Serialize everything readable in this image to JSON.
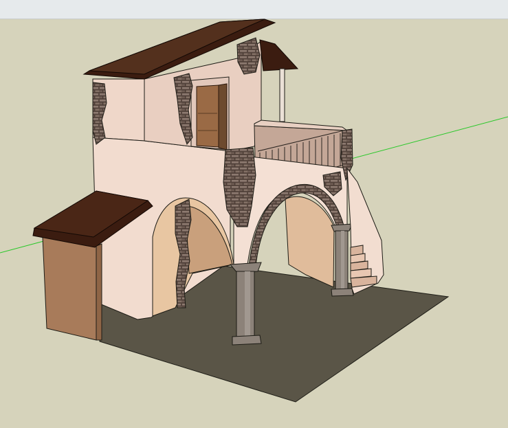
{
  "window": {
    "title": ""
  },
  "viewport": {
    "background": "#d6d3bb",
    "toolbar_background": "#e6eaec",
    "axis_green": "#28c828",
    "model": {
      "description_name": "two-storey-house-with-arched-loggia",
      "colors": {
        "plaster_light": "#f0d9cc",
        "plaster_mid": "#e2c3b4",
        "plaster_shadow": "#cfa999",
        "roof": "#3b1c10",
        "ground": "#5a5547",
        "stone": "#7a675e",
        "door_wood": "#9a6a45",
        "column": "#8c8279",
        "shed_wall": "#a87b5a"
      }
    }
  }
}
